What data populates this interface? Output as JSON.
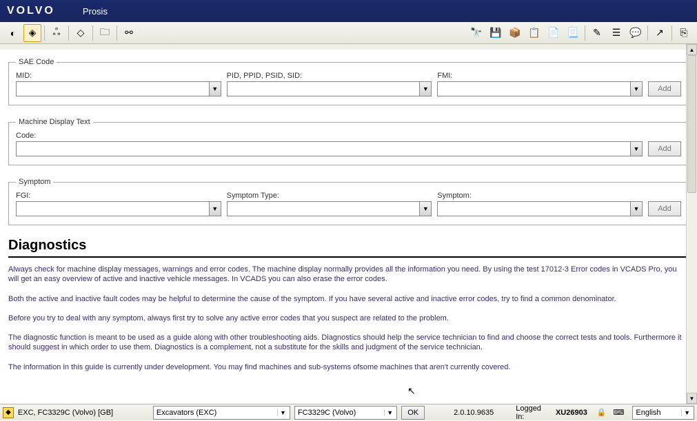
{
  "header": {
    "logo": "VOLVO",
    "app": "Prosis"
  },
  "toolbar_left": [
    {
      "name": "nav-prev-icon",
      "glyph": "◐",
      "active": false
    },
    {
      "name": "nav-cube-yellow-icon",
      "glyph": "◈",
      "active": true
    },
    {
      "name": "sep"
    },
    {
      "name": "tree-icon",
      "glyph": "ஃ",
      "active": false
    },
    {
      "name": "sep"
    },
    {
      "name": "cube-blue-icon",
      "glyph": "◇",
      "active": false
    },
    {
      "name": "sep"
    },
    {
      "name": "folder-icon",
      "glyph": "🗀",
      "active": false
    },
    {
      "name": "sep"
    },
    {
      "name": "link-icon",
      "glyph": "⚯",
      "active": false
    }
  ],
  "toolbar_right": [
    {
      "name": "binoculars-icon",
      "glyph": "🔭"
    },
    {
      "name": "save-clip-icon",
      "glyph": "💾"
    },
    {
      "name": "box-icon",
      "glyph": "📦"
    },
    {
      "name": "copy-out-icon",
      "glyph": "📋"
    },
    {
      "name": "paste-icon",
      "glyph": "📄"
    },
    {
      "name": "page-icon",
      "glyph": "📃"
    },
    {
      "name": "sep"
    },
    {
      "name": "edit-icon",
      "glyph": "✎"
    },
    {
      "name": "form-icon",
      "glyph": "☰"
    },
    {
      "name": "chat-icon",
      "glyph": "💬"
    },
    {
      "name": "sep"
    },
    {
      "name": "export-icon",
      "glyph": "↗"
    },
    {
      "name": "sep"
    },
    {
      "name": "exit-icon",
      "glyph": "⎘"
    }
  ],
  "sae": {
    "legend": "SAE Code",
    "mid_label": "MID:",
    "pid_label": "PID, PPID, PSID, SID:",
    "fmi_label": "FMI:",
    "add": "Add"
  },
  "mdt": {
    "legend": "Machine Display Text",
    "code_label": "Code:",
    "add": "Add"
  },
  "symptom": {
    "legend": "Symptom",
    "fgi_label": "FGI:",
    "type_label": "Symptom Type:",
    "symptom_label": "Symptom:",
    "add": "Add"
  },
  "diag": {
    "title": "Diagnostics",
    "p1": "Always check for machine display messages, warnings and error codes. The machine display normally provides all the information you need. By using the test 17012-3 Error codes in VCADS Pro, you will get an easy overview of active and inactive vehicle messages. In VCADS you can also erase the error codes.",
    "p2": "Both the active and inactive fault codes may be helpful to determine the cause of the symptom. If you have several active and inactive error codes, try to find a common denominator.",
    "p3": "Before you try to deal with any symptom, always first try to solve any active error codes that you suspect are related to the problem.",
    "p4": "The diagnostic function is meant to be used as a guide along with other troubleshooting aids. Diagnostics should help the service technician to find and choose the correct tests and tools. Furthermore it should suggest in which order to use them. Diagnostics is a complement, not a substitute for the skills and judgment of the service technician.",
    "p5": "The information in this guide is currently under development. You may find machines and sub-systems ofsome machines that aren't currently covered."
  },
  "status": {
    "machine_path": "EXC, FC3329C (Volvo) [GB]",
    "category": "Excavators (EXC)",
    "model": "FC3329C (Volvo)",
    "ok": "OK",
    "version": "2.0.10.9635",
    "logged_in_label": "Logged In:",
    "user": "XU26903",
    "language": "English"
  }
}
